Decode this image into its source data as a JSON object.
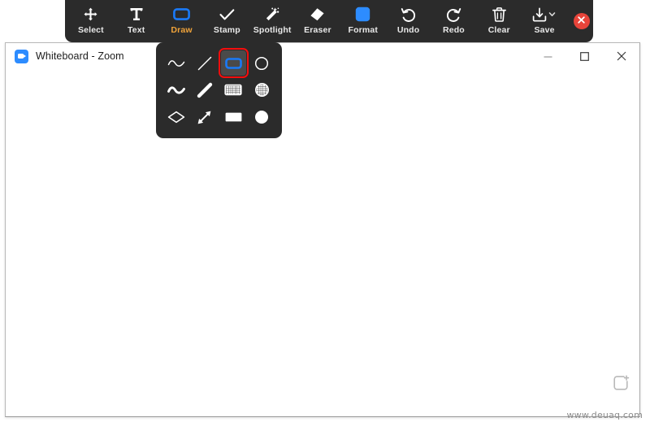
{
  "window": {
    "title": "Whiteboard - Zoom",
    "logo_icon": "zoom-camera-icon",
    "controls": [
      {
        "name": "minimize",
        "icon": "minimize-icon"
      },
      {
        "name": "maximize",
        "icon": "maximize-icon"
      },
      {
        "name": "close",
        "icon": "close-icon"
      }
    ]
  },
  "toolbar": {
    "background": "#2b2b2b",
    "active_color": "#f0a33a",
    "close_button": {
      "name": "close-toolbar-button",
      "icon": "close-circle-icon",
      "color": "#e8443a"
    },
    "items": [
      {
        "label": "Select",
        "icon": "move-arrows-icon",
        "active": false
      },
      {
        "label": "Text",
        "icon": "text-t-icon",
        "active": false
      },
      {
        "label": "Draw",
        "icon": "rectangle-outline-icon",
        "active": true
      },
      {
        "label": "Stamp",
        "icon": "check-icon",
        "active": false
      },
      {
        "label": "Spotlight",
        "icon": "magic-wand-icon",
        "active": false
      },
      {
        "label": "Eraser",
        "icon": "eraser-icon",
        "active": false
      },
      {
        "label": "Format",
        "icon": "filled-square-icon",
        "active": false
      },
      {
        "label": "Undo",
        "icon": "undo-arrow-icon",
        "active": false
      },
      {
        "label": "Redo",
        "icon": "redo-arrow-icon",
        "active": false
      },
      {
        "label": "Clear",
        "icon": "trash-icon",
        "active": false
      },
      {
        "label": "Save",
        "icon": "save-download-icon",
        "active": false,
        "has_chevron": true
      }
    ]
  },
  "shape_dropdown": {
    "selected_index": 2,
    "selection_color": "#f40d0d",
    "items": [
      {
        "index": 0,
        "icon": "thin-squiggle-icon"
      },
      {
        "index": 1,
        "icon": "thin-line-icon"
      },
      {
        "index": 2,
        "icon": "rectangle-outline-blue-icon"
      },
      {
        "index": 3,
        "icon": "circle-outline-icon"
      },
      {
        "index": 4,
        "icon": "thick-squiggle-icon"
      },
      {
        "index": 5,
        "icon": "thick-line-icon"
      },
      {
        "index": 6,
        "icon": "hatched-rectangle-icon"
      },
      {
        "index": 7,
        "icon": "hatched-circle-icon"
      },
      {
        "index": 8,
        "icon": "diamond-outline-icon"
      },
      {
        "index": 9,
        "icon": "double-arrow-icon"
      },
      {
        "index": 10,
        "icon": "filled-rectangle-icon"
      },
      {
        "index": 11,
        "icon": "filled-circle-icon"
      }
    ]
  },
  "canvas": {
    "add_page_icon": "add-page-icon"
  },
  "watermark": {
    "text": "www.deuaq.com"
  }
}
